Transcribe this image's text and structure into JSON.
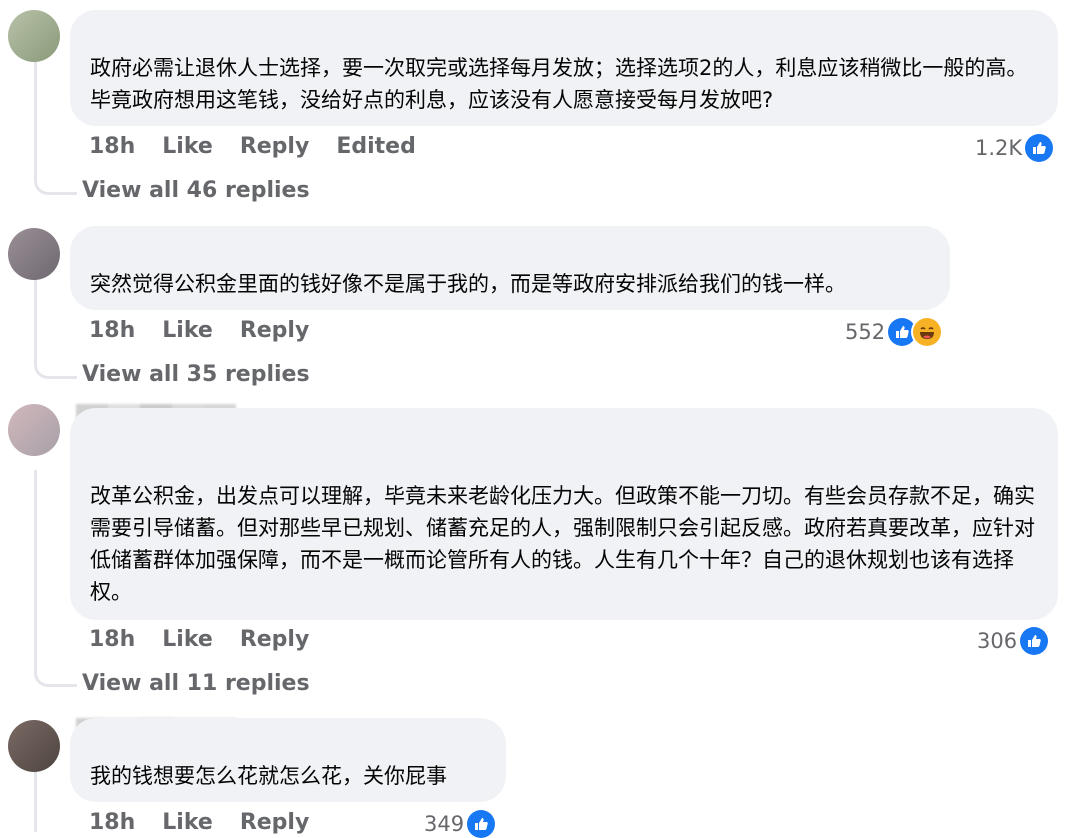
{
  "comments": [
    {
      "body": "政府必需让退休人士选择，要一次取完或选择每月发放；选择选项2的人，利息应该稍微比一般的高。毕竟政府想用这笔钱，没给好点的利息，应该没有人愿意接受每月发放吧?",
      "time": "18h",
      "like_label": "Like",
      "reply_label": "Reply",
      "edited_label": "Edited",
      "reaction_count": "1.2K",
      "view_replies": "View all 46 replies"
    },
    {
      "body": "突然觉得公积金里面的钱好像不是属于我的，而是等政府安排派给我们的钱一样。",
      "time": "18h",
      "like_label": "Like",
      "reply_label": "Reply",
      "reaction_count": "552",
      "view_replies": "View all 35 replies"
    },
    {
      "body": "改革公积金，出发点可以理解，毕竟未来老龄化压力大。但政策不能一刀切。有些会员存款不足，确实需要引导储蓄。但对那些早已规划、储蓄充足的人，强制限制只会引起反感。政府若真要改革，应针对低储蓄群体加强保障，而不是一概而论管所有人的钱。人生有几个十年？自己的退休规划也该有选择权。",
      "time": "18h",
      "like_label": "Like",
      "reply_label": "Reply",
      "reaction_count": "306",
      "view_replies": "View all 11 replies"
    },
    {
      "body": "我的钱想要怎么花就怎么花，关你屁事",
      "time": "18h",
      "like_label": "Like",
      "reply_label": "Reply",
      "reaction_count": "349"
    }
  ],
  "icons": {
    "like": "thumbs-up-icon",
    "haha": "laughing-face-icon"
  },
  "colors": {
    "like_blue": "#1877f2",
    "bubble_bg": "#f0f2f5",
    "meta_gray": "#65676b"
  }
}
